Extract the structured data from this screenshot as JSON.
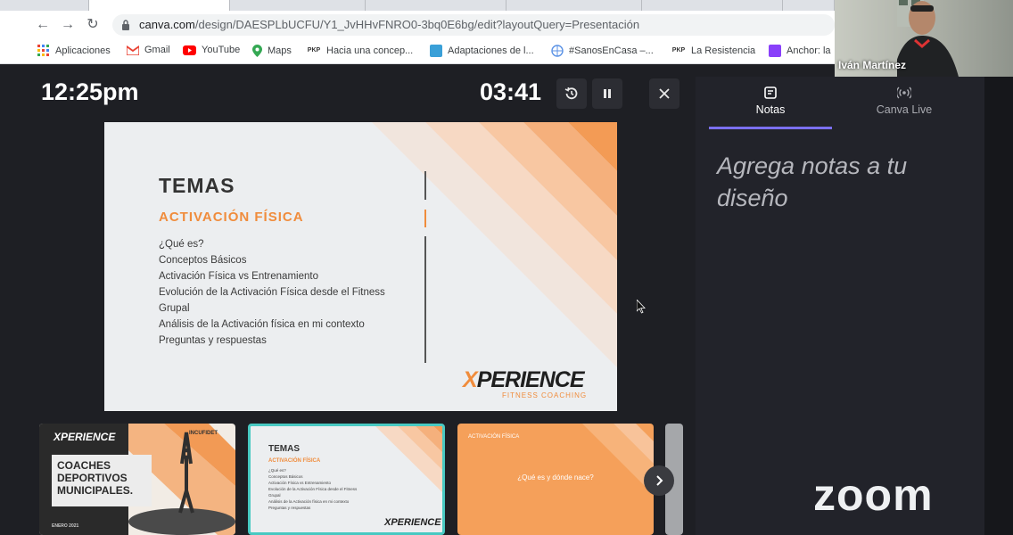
{
  "browser": {
    "url_host": "canva.com",
    "url_path": "/design/DAESPLbUCFU/Y1_JvHHvFNRO0-3bq0E6bg/edit?layoutQuery=Presentación",
    "bookmarks": [
      {
        "label": "Aplicaciones",
        "icon": "apps-grid-icon"
      },
      {
        "label": "Gmail",
        "icon": "gmail-icon"
      },
      {
        "label": "YouTube",
        "icon": "youtube-icon"
      },
      {
        "label": "Maps",
        "icon": "maps-pin-icon"
      },
      {
        "label": "Hacia una concep...",
        "icon": "pkp-icon"
      },
      {
        "label": "Adaptaciones de l...",
        "icon": "bookmark-blue-icon"
      },
      {
        "label": "#SanosEnCasa –...",
        "icon": "un-globe-icon"
      },
      {
        "label": "La Resistencia",
        "icon": "pkp-icon"
      },
      {
        "label": "Anchor: la",
        "icon": "anchor-icon"
      }
    ]
  },
  "video": {
    "participant_name": "Iván Martínez"
  },
  "presenter": {
    "clock": "12:25pm",
    "timer": "03:41"
  },
  "slide": {
    "title": "TEMAS",
    "subtitle": "ACTIVACIÓN FÍSICA",
    "topics": [
      "¿Qué es?",
      "Conceptos Básicos",
      "Activación Física vs Entrenamiento",
      "Evolución de la Activación Física desde el Fitness",
      "Grupal",
      "Análisis de la Activación física en mi contexto",
      "Preguntas y respuestas"
    ],
    "logo_main": "PERIENCE",
    "logo_x": "X",
    "logo_sub": "FITNESS COACHING"
  },
  "thumbnails": {
    "t1": {
      "logo": "XPERIENCE",
      "badge": "INCUFIDET",
      "title_lines": [
        "COACHES",
        "DEPORTIVOS",
        "MUNICIPALES."
      ],
      "date": "ENERO 2021"
    },
    "t2": {
      "title": "TEMAS",
      "subtitle": "ACTIVACIÓN FÍSICA",
      "lines": [
        "¿Qué es?",
        "Conceptos Básicos",
        "Activación Física vs Entrenamiento",
        "Evolución de la Activación Física desde el Fitness",
        "Grupal",
        "Análisis de la Activación física en mi contexto",
        "Preguntas y respuestas"
      ],
      "logo": "XPERIENCE"
    },
    "t3": {
      "label": "ACTIVACIÓN FÍSICA",
      "question": "¿Qué es y dónde nace?"
    }
  },
  "panel": {
    "tab_notes": "Notas",
    "tab_live": "Canva Live",
    "notes_placeholder": "Agrega notas a tu diseño"
  },
  "zoom_watermark": "zoom",
  "colors": {
    "accent_orange": "#f08c3c",
    "active_tab": "#7b6ff0",
    "selected_thumb": "#48c9c2"
  }
}
